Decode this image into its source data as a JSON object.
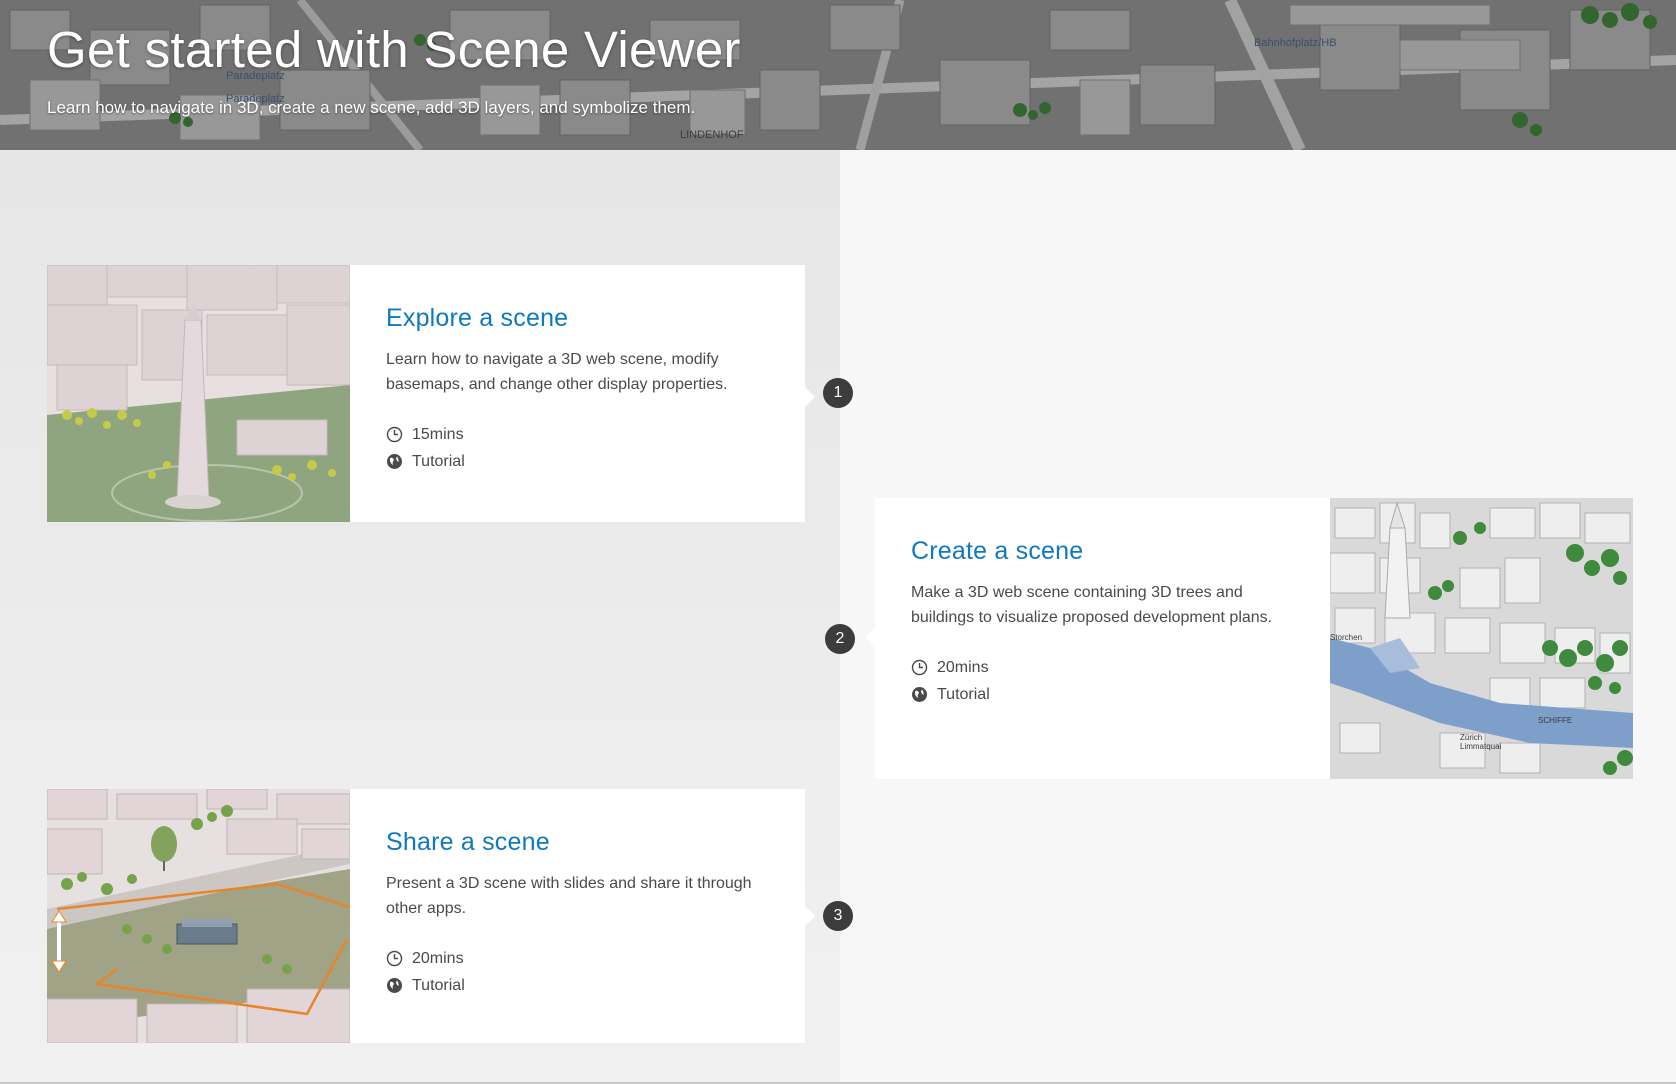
{
  "header": {
    "title": "Get started with Scene Viewer",
    "subtitle": "Learn how to navigate in 3D, create a new scene, add 3D layers, and symbolize them.",
    "map_labels": [
      "Paradeplatz",
      "Paradeplatz",
      "LINDENHOF",
      "Bahnhofplatz/HB"
    ]
  },
  "cards": [
    {
      "step": "1",
      "title": "Explore a scene",
      "description": "Learn how to navigate a 3D web scene, modify basemaps, and change other display properties.",
      "duration": "15mins",
      "type": "Tutorial",
      "image_labels": []
    },
    {
      "step": "2",
      "title": "Create a scene",
      "description": "Make a 3D web scene containing 3D trees and buildings to visualize proposed development plans.",
      "duration": "20mins",
      "type": "Tutorial",
      "image_labels": [
        "Storchen",
        "SCHIFFE",
        "Zürich Limmatquai"
      ]
    },
    {
      "step": "3",
      "title": "Share a scene",
      "description": "Present a 3D scene with slides and share it through other apps.",
      "duration": "20mins",
      "type": "Tutorial",
      "image_labels": []
    }
  ],
  "icons": {
    "duration": "clock-icon",
    "type": "globe-icon"
  },
  "colors": {
    "title_blue": "#0f79bf",
    "step_marker": "#3c3c3c",
    "card_bg": "#ffffff",
    "left_column_bg": "#e9e9e9",
    "right_column_bg": "#f7f7f7"
  }
}
